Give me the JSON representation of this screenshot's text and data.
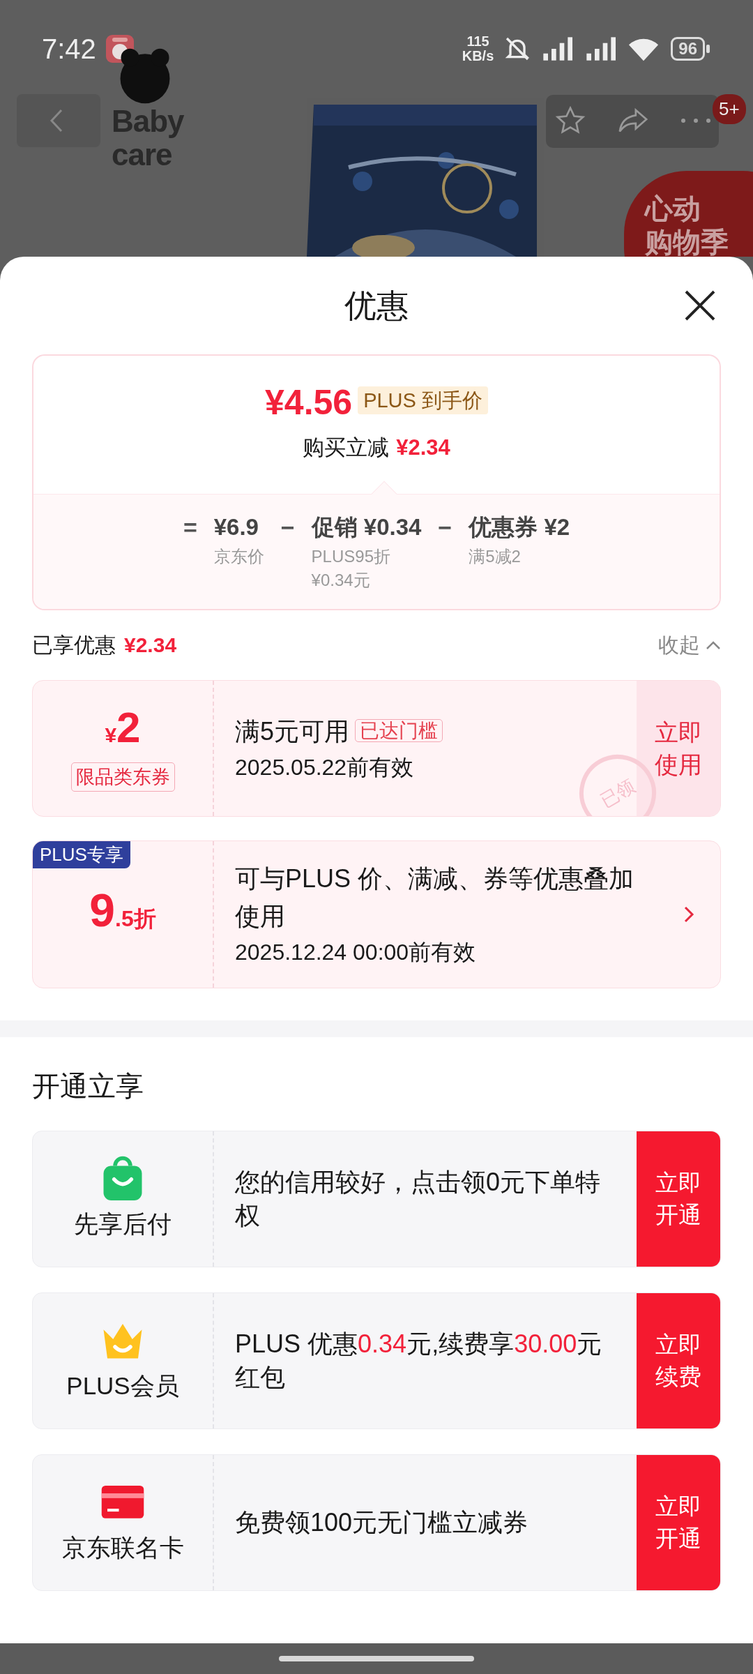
{
  "status_bar": {
    "time": "7:42",
    "speed_value": "115",
    "speed_unit": "KB/s",
    "battery": "96"
  },
  "background": {
    "logo_lines": [
      "Baby",
      "care"
    ],
    "cart_badge": "5+",
    "promo_lines": [
      "心动",
      "购物季"
    ]
  },
  "sheet": {
    "title": "优惠"
  },
  "price_summary": {
    "price": "¥4.56",
    "price_tag": "PLUS 到手价",
    "instant_label": "购买立减",
    "instant_amount": "¥2.34",
    "breakdown": [
      {
        "operator": "=",
        "amount": "¥6.9",
        "notes": [
          "京东价"
        ]
      },
      {
        "operator": "−",
        "amount": "促销 ¥0.34",
        "notes": [
          "PLUS95折",
          "¥0.34元"
        ]
      },
      {
        "operator": "−",
        "amount": "优惠券 ¥2",
        "notes": [
          "满5减2"
        ]
      }
    ]
  },
  "enjoyed": {
    "label": "已享优惠",
    "amount": "¥2.34",
    "toggle": "收起",
    "expanded": true
  },
  "coupons": [
    {
      "kind": "coupon",
      "currency": "¥",
      "value": "2",
      "tag": "限品类东券",
      "condition": "满5元可用",
      "status_tag": "已达门槛",
      "validity": "2025.05.22前有效",
      "action": "立即使用",
      "stamp": "已领"
    },
    {
      "kind": "discount",
      "ribbon": "PLUS专享",
      "value": "9",
      "value_suffix": ".5折",
      "description": "可与PLUS 价、满减、券等优惠叠加使用",
      "validity": "2025.12.24 00:00前有效"
    }
  ],
  "offers_title": "开通立享",
  "offers": [
    {
      "kind": "pay_later",
      "name": "先享后付",
      "description": [
        {
          "text": "您的信用较好，点击领0元下单特权",
          "highlight": false
        }
      ],
      "action": "立即开通"
    },
    {
      "kind": "membership",
      "name": "PLUS会员",
      "description": [
        {
          "text": "PLUS 优惠",
          "highlight": false
        },
        {
          "text": "0.34",
          "highlight": true
        },
        {
          "text": "元,续费享",
          "highlight": false
        },
        {
          "text": "30.00",
          "highlight": true
        },
        {
          "text": "元红包",
          "highlight": false
        }
      ],
      "action": "立即续费"
    },
    {
      "kind": "card",
      "name": "京东联名卡",
      "description": [
        {
          "text": "免费领100元无门槛立减券",
          "highlight": false
        }
      ],
      "action": "立即开通"
    }
  ]
}
